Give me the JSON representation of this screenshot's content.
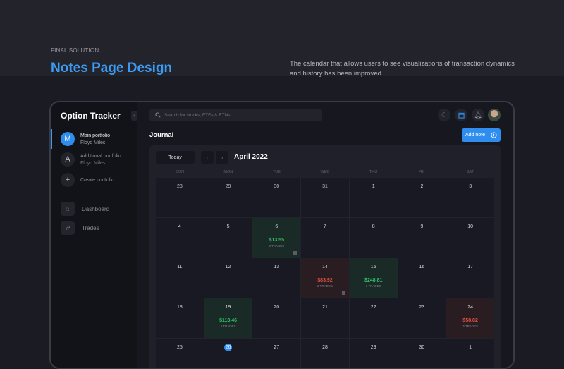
{
  "header": {
    "eyebrow": "FINAL SOLUTION",
    "title": "Notes Page Design",
    "description": "The calendar that allows users to see visualizations of transaction dynamics and history has been improved."
  },
  "app": {
    "logo": "Option Tracker",
    "collapse": "‹",
    "portfolios": [
      {
        "initial": "M",
        "name": "Main portfolio",
        "owner": "Floyd Miles"
      },
      {
        "initial": "A",
        "name": "Additional portfolio",
        "owner": "Floyd Miles"
      }
    ],
    "create": {
      "icon": "+",
      "label": "Create portfolio"
    },
    "nav": [
      {
        "icon": "⌂",
        "label": "Dashboard"
      },
      {
        "icon": "⇗",
        "label": "Trades"
      }
    ],
    "search": {
      "placeholder": "Search for stocks, ETFs & ETNs"
    },
    "journal": "Journal",
    "add_note": "Add note",
    "calendar": {
      "today": "Today",
      "prev": "‹",
      "next": "›",
      "month": "April 2022",
      "weekdays": [
        "SUN",
        "MON",
        "TUE",
        "WED",
        "THU",
        "FRI",
        "SAT"
      ],
      "colors": {
        "positive": "#2fc26a",
        "negative": "#e0523f",
        "accent": "#2f8df0"
      },
      "days": [
        {
          "d": "28",
          "out": true
        },
        {
          "d": "29",
          "out": true
        },
        {
          "d": "30",
          "out": true
        },
        {
          "d": "31",
          "out": true
        },
        {
          "d": "1"
        },
        {
          "d": "2"
        },
        {
          "d": "3"
        },
        {
          "d": "4"
        },
        {
          "d": "5"
        },
        {
          "d": "6",
          "amount": "$13.55",
          "trades": "2 TRADES",
          "type": "pos",
          "note": true
        },
        {
          "d": "7"
        },
        {
          "d": "8"
        },
        {
          "d": "9"
        },
        {
          "d": "10"
        },
        {
          "d": "11"
        },
        {
          "d": "12"
        },
        {
          "d": "13"
        },
        {
          "d": "14",
          "amount": "$83.92",
          "trades": "2 TRADES",
          "type": "neg",
          "note": true
        },
        {
          "d": "15",
          "amount": "$248.81",
          "trades": "1 TRADES",
          "type": "pos"
        },
        {
          "d": "16"
        },
        {
          "d": "17"
        },
        {
          "d": "18"
        },
        {
          "d": "19",
          "amount": "$113.46",
          "trades": "4 TRADES",
          "type": "pos"
        },
        {
          "d": "20"
        },
        {
          "d": "21"
        },
        {
          "d": "22"
        },
        {
          "d": "23"
        },
        {
          "d": "24",
          "amount": "$58.82",
          "trades": "3 TRADES",
          "type": "neg"
        },
        {
          "d": "25"
        },
        {
          "d": "26",
          "current": true
        },
        {
          "d": "27"
        },
        {
          "d": "28"
        },
        {
          "d": "29"
        },
        {
          "d": "30"
        },
        {
          "d": "1",
          "out": true
        }
      ]
    }
  }
}
